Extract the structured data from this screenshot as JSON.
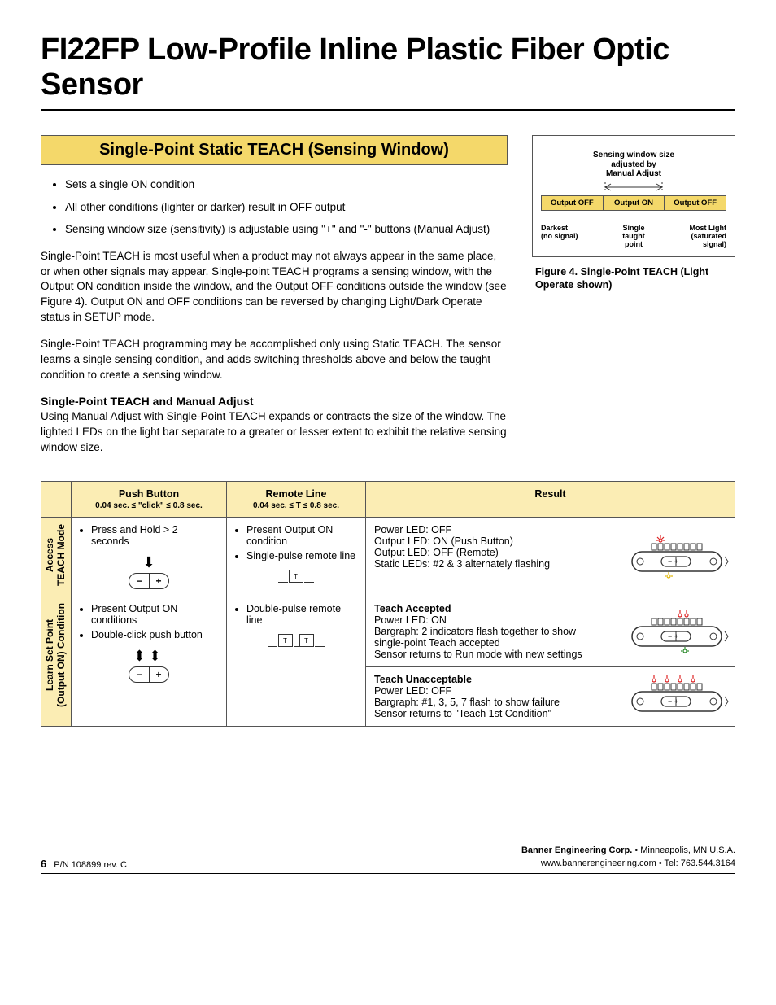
{
  "title": "FI22FP Low-Profile Inline Plastic Fiber Optic Sensor",
  "section_header": "Single-Point Static TEACH (Sensing Window)",
  "bullets": [
    "Sets a single ON condition",
    "All other conditions (lighter or darker) result in OFF output",
    "Sensing window size (sensitivity) is adjustable using  \"+\" and  \"-\" buttons (Manual Adjust)"
  ],
  "para1": "Single-Point TEACH is most useful when a product may not always appear in the same place, or when other signals may appear. Single-point TEACH programs a sensing window, with the Output ON condition inside the window, and the Output OFF conditions outside the window (see Figure 4). Output ON and OFF conditions can be reversed by changing Light/Dark Operate status in SETUP mode.",
  "para2": "Single-Point TEACH programming may be accomplished only using Static TEACH. The sensor learns a single sensing condition, and adds switching thresholds above and below the taught condition to create a sensing window.",
  "subhead": "Single-Point TEACH and Manual Adjust",
  "para3": "Using Manual Adjust with Single-Point TEACH expands or contracts the size of the window. The lighted LEDs on the light bar separate to a greater or lesser extent to exhibit the relative sensing window size.",
  "figure": {
    "top_label": "Sensing window size\nadjusted by\nManual Adjust",
    "segments": [
      "Output OFF",
      "Output ON",
      "Output OFF"
    ],
    "labels": {
      "left": "Darkest\n(no signal)",
      "center": "Single\ntaught\npoint",
      "right": "Most Light\n(saturated\nsignal)"
    },
    "caption": "Figure 4.  Single-Point TEACH (Light Operate shown)"
  },
  "table": {
    "headers": {
      "push_button": "Push Button",
      "push_button_sub": "0.04 sec. ≤ \"click\" ≤  0.8 sec.",
      "remote_line": "Remote Line",
      "remote_line_sub": "0.04 sec. ≤ T ≤  0.8 sec.",
      "result": "Result"
    },
    "rows": [
      {
        "rowhead": "Access\nTEACH Mode",
        "pb": [
          "Press and Hold > 2 seconds"
        ],
        "rl": [
          "Present Output ON condition",
          "Single-pulse remote line"
        ],
        "result_lines": [
          "Power LED: OFF",
          "Output LED: ON (Push Button)",
          "Output LED: OFF (Remote)",
          "Static LEDs: #2 & 3 alternately flashing"
        ],
        "accepted_heading": "",
        "pb_icon": "hold",
        "rl_icon": "single",
        "sensor": "a"
      },
      {
        "rowhead": "Learn Set Point\n(Output ON) Condition",
        "pb": [
          "Present Output ON conditions",
          "Double-click push button"
        ],
        "rl": [
          "Double-pulse remote line"
        ],
        "result_blocks": [
          {
            "heading": "Teach Accepted",
            "lines": [
              "Power LED: ON",
              "Bargraph: 2 indicators flash together to show single-point Teach accepted",
              "Sensor returns to Run mode with new settings"
            ],
            "sensor": "b"
          },
          {
            "heading": "Teach Unacceptable",
            "lines": [
              "Power LED: OFF",
              "Bargraph: #1, 3, 5, 7 flash to show failure",
              "Sensor returns to \"Teach 1st Condition\""
            ],
            "sensor": "c"
          }
        ],
        "pb_icon": "double",
        "rl_icon": "double"
      }
    ]
  },
  "footer": {
    "page_num": "6",
    "pn": "P/N 108899 rev. C",
    "company": "Banner Engineering Corp.",
    "city": " • Minneapolis, MN U.S.A.",
    "line2": "www.bannerengineering.com  •  Tel: 763.544.3164"
  }
}
